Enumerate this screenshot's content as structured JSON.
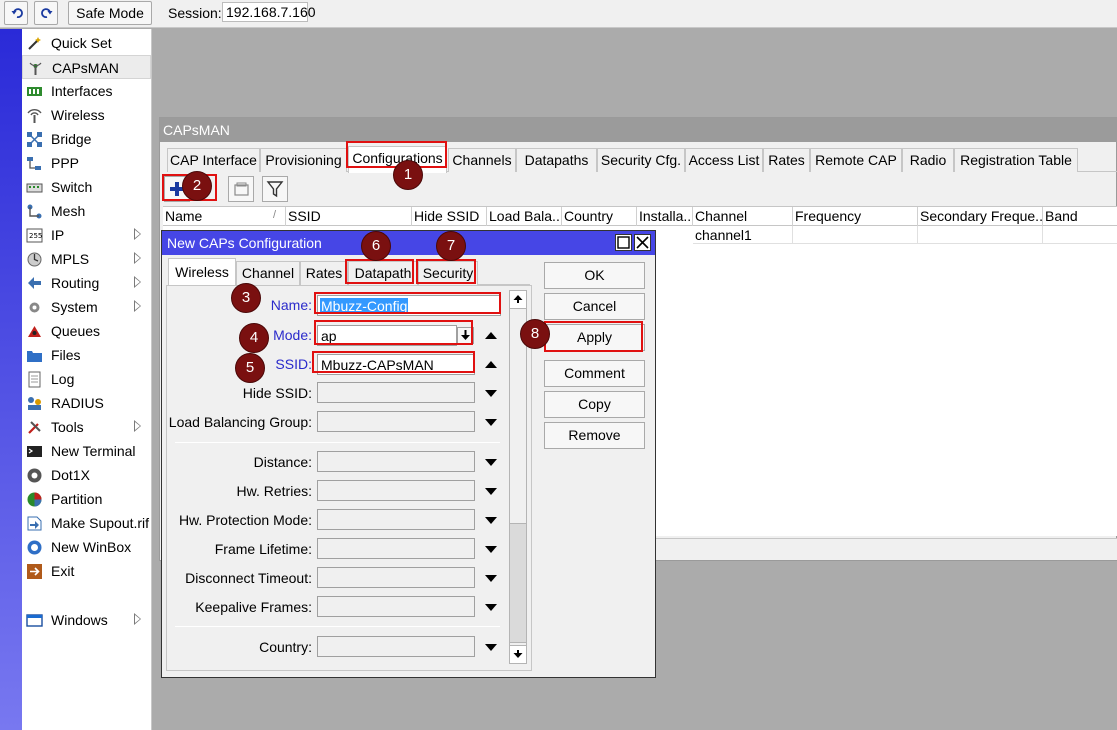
{
  "toolbar": {
    "safe_mode_label": "Safe Mode",
    "session_label": "Session:",
    "session_value": "192.168.7.160"
  },
  "sidebar": {
    "items": [
      {
        "label": "Quick Set",
        "icon": "wand-icon",
        "arrow": false
      },
      {
        "label": "CAPsMAN",
        "icon": "antenna-icon",
        "arrow": false,
        "active": true
      },
      {
        "label": "Interfaces",
        "icon": "interfaces-icon",
        "arrow": false
      },
      {
        "label": "Wireless",
        "icon": "wireless-icon",
        "arrow": false
      },
      {
        "label": "Bridge",
        "icon": "bridge-icon",
        "arrow": false
      },
      {
        "label": "PPP",
        "icon": "ppp-icon",
        "arrow": false
      },
      {
        "label": "Switch",
        "icon": "switch-icon",
        "arrow": false
      },
      {
        "label": "Mesh",
        "icon": "mesh-icon",
        "arrow": false
      },
      {
        "label": "IP",
        "icon": "ip-icon",
        "arrow": true
      },
      {
        "label": "MPLS",
        "icon": "mpls-icon",
        "arrow": true
      },
      {
        "label": "Routing",
        "icon": "routing-icon",
        "arrow": true
      },
      {
        "label": "System",
        "icon": "system-gear-icon",
        "arrow": true
      },
      {
        "label": "Queues",
        "icon": "queues-icon",
        "arrow": false
      },
      {
        "label": "Files",
        "icon": "folder-icon",
        "arrow": false
      },
      {
        "label": "Log",
        "icon": "log-icon",
        "arrow": false
      },
      {
        "label": "RADIUS",
        "icon": "radius-icon",
        "arrow": false
      },
      {
        "label": "Tools",
        "icon": "tools-icon",
        "arrow": true
      },
      {
        "label": "New Terminal",
        "icon": "terminal-icon",
        "arrow": false
      },
      {
        "label": "Dot1X",
        "icon": "dot1x-icon",
        "arrow": false
      },
      {
        "label": "Partition",
        "icon": "partition-icon",
        "arrow": false
      },
      {
        "label": "Make Supout.rif",
        "icon": "supout-icon",
        "arrow": false
      },
      {
        "label": "New WinBox",
        "icon": "winbox-icon",
        "arrow": false
      },
      {
        "label": "Exit",
        "icon": "exit-icon",
        "arrow": false
      }
    ],
    "windows_label": "Windows"
  },
  "capsman": {
    "title": "CAPsMAN",
    "tabs": [
      "CAP Interface",
      "Provisioning",
      "Configurations",
      "Channels",
      "Datapaths",
      "Security Cfg.",
      "Access List",
      "Rates",
      "Remote CAP",
      "Radio",
      "Registration Table"
    ],
    "active_tab": "Configurations",
    "columns": [
      "Name",
      "SSID",
      "Hide SSID",
      "Load Bala...",
      "Country",
      "Installa...",
      "Channel",
      "Frequency",
      "Secondary Freque...",
      "Band"
    ],
    "rows": [
      {
        "channel": "channel1"
      }
    ]
  },
  "dialog": {
    "title": "New CAPs Configuration",
    "tabs": [
      "Wireless",
      "Channel",
      "Rates",
      "Datapath",
      "Security"
    ],
    "active_tab": "Wireless",
    "fields": {
      "name_label": "Name:",
      "name_value": "Mbuzz-Config",
      "mode_label": "Mode:",
      "mode_value": "ap",
      "ssid_label": "SSID:",
      "ssid_value": "Mbuzz-CAPsMAN",
      "hide_ssid_label": "Hide SSID:",
      "lb_group_label": "Load Balancing Group:",
      "distance_label": "Distance:",
      "hw_retries_label": "Hw. Retries:",
      "hw_protection_label": "Hw. Protection Mode:",
      "frame_lifetime_label": "Frame Lifetime:",
      "disconnect_timeout_label": "Disconnect Timeout:",
      "keepalive_label": "Keepalive Frames:",
      "country_label": "Country:"
    },
    "buttons": {
      "ok": "OK",
      "cancel": "Cancel",
      "apply": "Apply",
      "comment": "Comment",
      "copy": "Copy",
      "remove": "Remove"
    }
  },
  "badges": [
    "1",
    "2",
    "3",
    "4",
    "5",
    "6",
    "7",
    "8"
  ],
  "colors": {
    "annotation_red": "#e01010",
    "badge_fill": "#7a1010",
    "dialog_titlebar": "#4646e6",
    "field_label_blue": "#2a2acb"
  }
}
